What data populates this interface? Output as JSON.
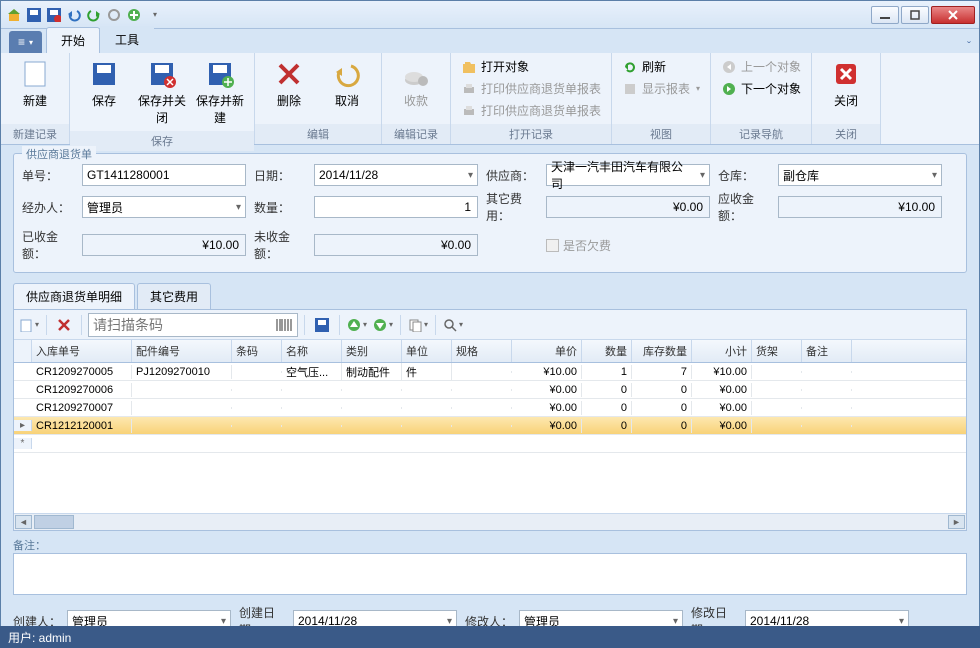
{
  "qat_icons": [
    "home",
    "save",
    "save-close",
    "undo",
    "redo",
    "refresh",
    "add"
  ],
  "window": {
    "min": "min",
    "max": "max",
    "close": "close"
  },
  "ribbon_tabs": {
    "file": "≡▾",
    "start": "开始",
    "tools": "工具"
  },
  "ribbon": {
    "groups": {
      "new_record": "新建记录",
      "save": "保存",
      "edit": "编辑",
      "edit_record": "编辑记录",
      "open_record": "打开记录",
      "view": "视图",
      "nav": "记录导航",
      "close": "关闭"
    },
    "btns": {
      "new": "新建",
      "save": "保存",
      "save_close": "保存并关闭",
      "save_new": "保存并新建",
      "delete": "删除",
      "cancel": "取消",
      "collect": "收款",
      "open_obj": "打开对象",
      "print1": "打印供应商退货单报表",
      "print2": "打印供应商退货单报表",
      "refresh": "刷新",
      "show_report": "显示报表",
      "prev": "上一个对象",
      "next": "下一个对象",
      "close": "关闭"
    }
  },
  "form": {
    "title": "供应商退货单",
    "labels": {
      "no": "单号：",
      "date": "日期：",
      "supplier": "供应商：",
      "warehouse": "仓库：",
      "handler": "经办人：",
      "qty": "数量：",
      "other_fee": "其它费用：",
      "receivable": "应收金额：",
      "received": "已收金额：",
      "unreceived": "未收金额：",
      "is_owed": "是否欠费"
    },
    "values": {
      "no": "GT1411280001",
      "date": "2014/11/28",
      "supplier": "天津一汽丰田汽车有限公司",
      "warehouse": "副仓库",
      "handler": "管理员",
      "qty": "1",
      "other_fee": "¥0.00",
      "receivable": "¥10.00",
      "received": "¥10.00",
      "unreceived": "¥0.00"
    }
  },
  "tabs": {
    "detail": "供应商退货单明细",
    "other_fee": "其它费用"
  },
  "barcode_placeholder": "请扫描条码",
  "grid": {
    "cols": [
      "入库单号",
      "配件编号",
      "条码",
      "名称",
      "类别",
      "单位",
      "规格",
      "单价",
      "数量",
      "库存数量",
      "小计",
      "货架",
      "备注"
    ],
    "rows": [
      {
        "inno": "CR1209270005",
        "partno": "PJ1209270010",
        "barcode": "",
        "name": "空气压...",
        "cat": "制动配件",
        "unit": "件",
        "spec": "",
        "price": "¥10.00",
        "qty": "1",
        "stock": "7",
        "subtotal": "¥10.00",
        "shelf": "",
        "remark": ""
      },
      {
        "inno": "CR1209270006",
        "partno": "",
        "barcode": "",
        "name": "",
        "cat": "",
        "unit": "",
        "spec": "",
        "price": "¥0.00",
        "qty": "0",
        "stock": "0",
        "subtotal": "¥0.00",
        "shelf": "",
        "remark": ""
      },
      {
        "inno": "CR1209270007",
        "partno": "",
        "barcode": "",
        "name": "",
        "cat": "",
        "unit": "",
        "spec": "",
        "price": "¥0.00",
        "qty": "0",
        "stock": "0",
        "subtotal": "¥0.00",
        "shelf": "",
        "remark": ""
      },
      {
        "inno": "CR1212120001",
        "partno": "",
        "barcode": "",
        "name": "",
        "cat": "",
        "unit": "",
        "spec": "",
        "price": "¥0.00",
        "qty": "0",
        "stock": "0",
        "subtotal": "¥0.00",
        "shelf": "",
        "remark": "",
        "hl": true
      }
    ]
  },
  "remarks_label": "备注：",
  "footer": {
    "labels": {
      "creator": "创建人：",
      "create_date": "创建日期：",
      "modifier": "修改人：",
      "modify_date": "修改日期："
    },
    "values": {
      "creator": "管理员",
      "create_date": "2014/11/28",
      "modifier": "管理员",
      "modify_date": "2014/11/28"
    }
  },
  "status": "用户: admin"
}
